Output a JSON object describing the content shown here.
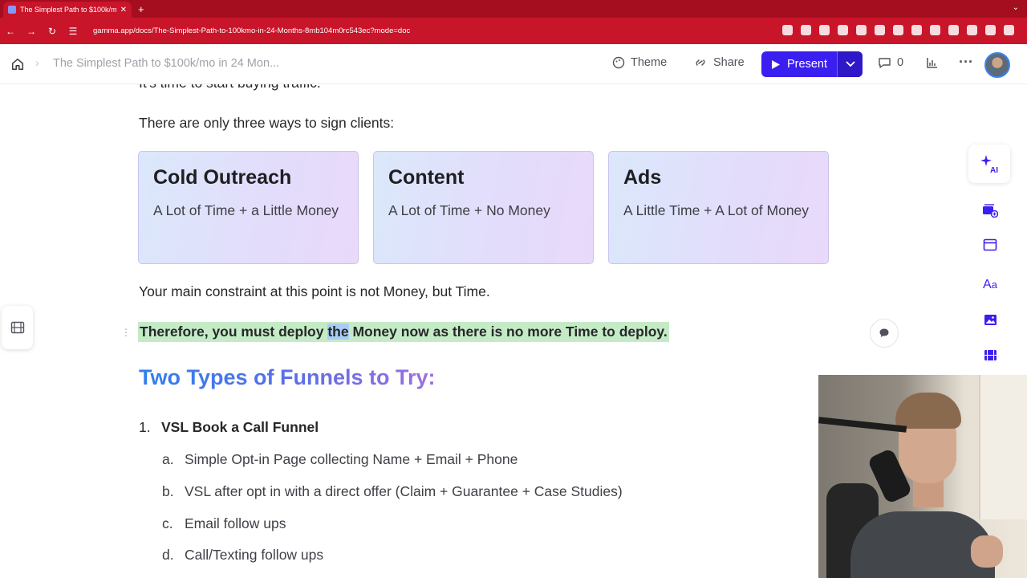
{
  "browser": {
    "tab_title": "The Simplest Path to $100k/m",
    "new_tab": "+",
    "url_host": "gamma.app",
    "url_path": "/docs/The-Simplest-Path-to-100kmo-in-24-Months-8mb104m0rc543ec?mode=doc"
  },
  "toolbar": {
    "doc_title": "The Simplest Path to $100k/mo in 24 Mon...",
    "theme_label": "Theme",
    "share_label": "Share",
    "present_label": "Present",
    "comment_count": "0"
  },
  "doc": {
    "cut_line": "It's time to start buying traffic.",
    "intro": "There are only three ways to sign clients:",
    "cards": [
      {
        "title": "Cold Outreach",
        "body": "A Lot of Time + a Little Money"
      },
      {
        "title": "Content",
        "body": "A Lot of Time + No Money"
      },
      {
        "title": "Ads",
        "body": "A Little Time + A Lot of Money"
      }
    ],
    "constraint": "Your main constraint at this point is not Money, but Time.",
    "highlight_pre": "Therefore, you must deploy ",
    "highlight_sel": "the",
    "highlight_post": " Money now as there is no more Time to deploy.",
    "heading": "Two Types of Funnels to Try:",
    "list_num": "1.",
    "list_item": "VSL Book a Call Funnel",
    "sub_items": [
      {
        "letter": "a.",
        "text": "Simple Opt-in Page collecting Name + Email + Phone"
      },
      {
        "letter": "b.",
        "text": "VSL after opt in with a direct offer (Claim + Guarantee + Case Studies)"
      },
      {
        "letter": "c.",
        "text": "Email follow ups"
      },
      {
        "letter": "d.",
        "text": "Call/Texting follow ups"
      }
    ]
  },
  "rail": {
    "ai_label": "AI"
  },
  "colors": {
    "browser_red": "#c8152a",
    "present_blue": "#3b1ff0",
    "highlight_green": "#c4ebc6",
    "selection_blue": "#a9cdf1"
  }
}
